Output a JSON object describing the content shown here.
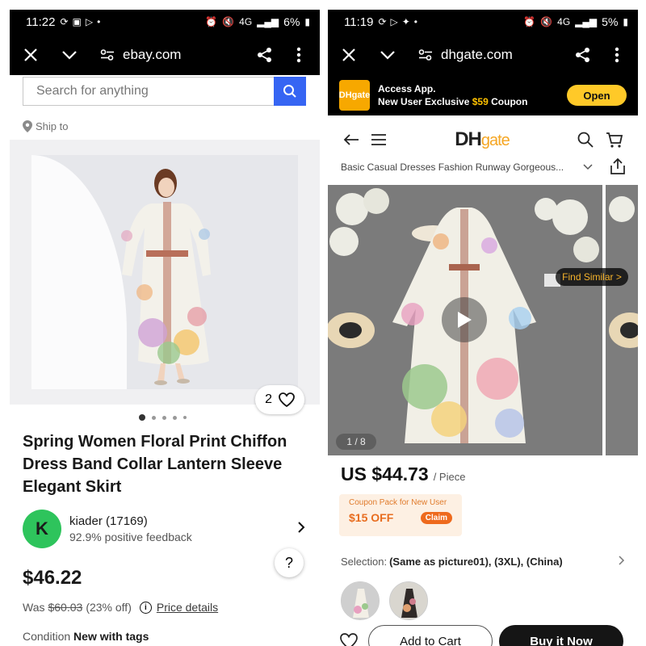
{
  "left": {
    "status": {
      "time": "11:22",
      "battery": "6%",
      "network": "4G"
    },
    "browser": {
      "url": "ebay.com"
    },
    "search": {
      "placeholder": "Search for anything"
    },
    "ship_to": "Ship to",
    "image": {
      "watch_count": "2",
      "dots_total": 5,
      "dots_active": 1
    },
    "title": "Spring Women Floral Print Chiffon Dress Band Collar Lantern Sleeve Elegant Skirt",
    "seller": {
      "initial": "K",
      "name": "kiader (17169)",
      "feedback": "92.9% positive feedback"
    },
    "help": "?",
    "price": "$46.22",
    "was": {
      "prefix": "Was",
      "old_price": "$60.03",
      "discount": "(23% off)",
      "details": "Price details"
    },
    "condition": {
      "label": "Condition",
      "value": "New with tags"
    }
  },
  "right": {
    "status": {
      "time": "11:19",
      "battery": "5%",
      "network": "4G"
    },
    "browser": {
      "url": "dhgate.com"
    },
    "banner": {
      "logo": "DHgate",
      "line1": "Access App.",
      "line2_prefix": "New User Exclusive",
      "line2_amount": "$59",
      "line2_suffix": "Coupon",
      "open": "Open"
    },
    "nav": {
      "brand_dh": "DH",
      "brand_gate": "gate"
    },
    "breadcrumb": "Basic Casual Dresses Fashion Runway Gorgeous...",
    "image": {
      "counter": "1 / 8",
      "find_similar": "Find Similar >"
    },
    "price": {
      "value": "US $44.73",
      "unit": "/ Piece"
    },
    "coupon": {
      "title": "Coupon Pack for New User",
      "off": "$15 OFF",
      "claim": "Claim"
    },
    "selection": {
      "label": "Selection:",
      "value": "(Same as picture01), (3XL), (China)"
    },
    "actions": {
      "add": "Add to Cart",
      "buy": "Buy it Now"
    }
  }
}
